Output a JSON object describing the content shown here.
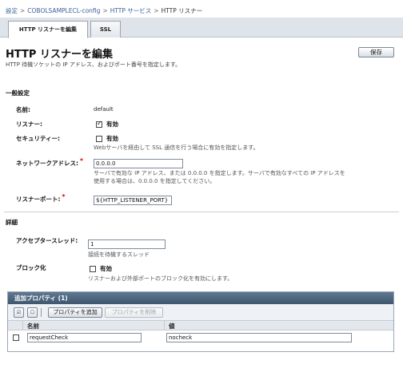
{
  "breadcrumb": {
    "items": [
      "設定",
      "COBOLSAMPLECL-config",
      "HTTP サービス"
    ],
    "separator": ">",
    "current": "HTTP リスナー"
  },
  "tabs": [
    {
      "label": "HTTP リスナーを編集",
      "active": true
    },
    {
      "label": "SSL",
      "active": false
    }
  ],
  "page": {
    "title": "HTTP リスナーを編集",
    "description": "HTTP 待機ソケットの IP アドレス、およびポート番号を指定します。",
    "save_label": "保存"
  },
  "general": {
    "heading": "一般設定",
    "name_label": "名前:",
    "name_value": "default",
    "listener_label": "リスナー:",
    "listener_checkbox": "有効",
    "listener_checked": true,
    "security_label": "セキュリティー:",
    "security_checkbox": "有効",
    "security_checked": false,
    "security_help": "Webサーバを経由して SSL 通信を行う場合に有効を指定します。",
    "network_label": "ネットワークアドレス:",
    "network_value": "0.0.0.0",
    "network_help_1": "サーバで有効な IP アドレス、または 0.0.0.0 を指定します。サーバで有効なすべての IP アドレスを",
    "network_help_2": "使用する場合は、0.0.0.0 を指定してください。",
    "port_label": "リスナーポート:",
    "port_value": "${HTTP_LISTENER_PORT}",
    "required_mark": "*"
  },
  "details": {
    "heading": "詳細",
    "acceptor_label": "アクセプタースレッド:",
    "acceptor_value": "1",
    "acceptor_help": "接続を待機するスレッド",
    "block_label": "ブロック化",
    "block_checkbox": "有効",
    "block_checked": false,
    "block_help": "リスナーおよび外部ポートのブロック化を有効にします。"
  },
  "properties": {
    "title": "追加プロパティ (1)",
    "add_button": "プロパティを追加",
    "delete_button": "プロパティを削除",
    "icons": [
      "select-all-icon",
      "deselect-all-icon"
    ],
    "columns": [
      "名前",
      "値"
    ],
    "rows": [
      {
        "name": "requestCheck",
        "value": "nocheck",
        "checked": false
      }
    ]
  },
  "colors": {
    "link": "#3a5f9a",
    "required": "#d40000",
    "table_header": "#4d657c"
  }
}
